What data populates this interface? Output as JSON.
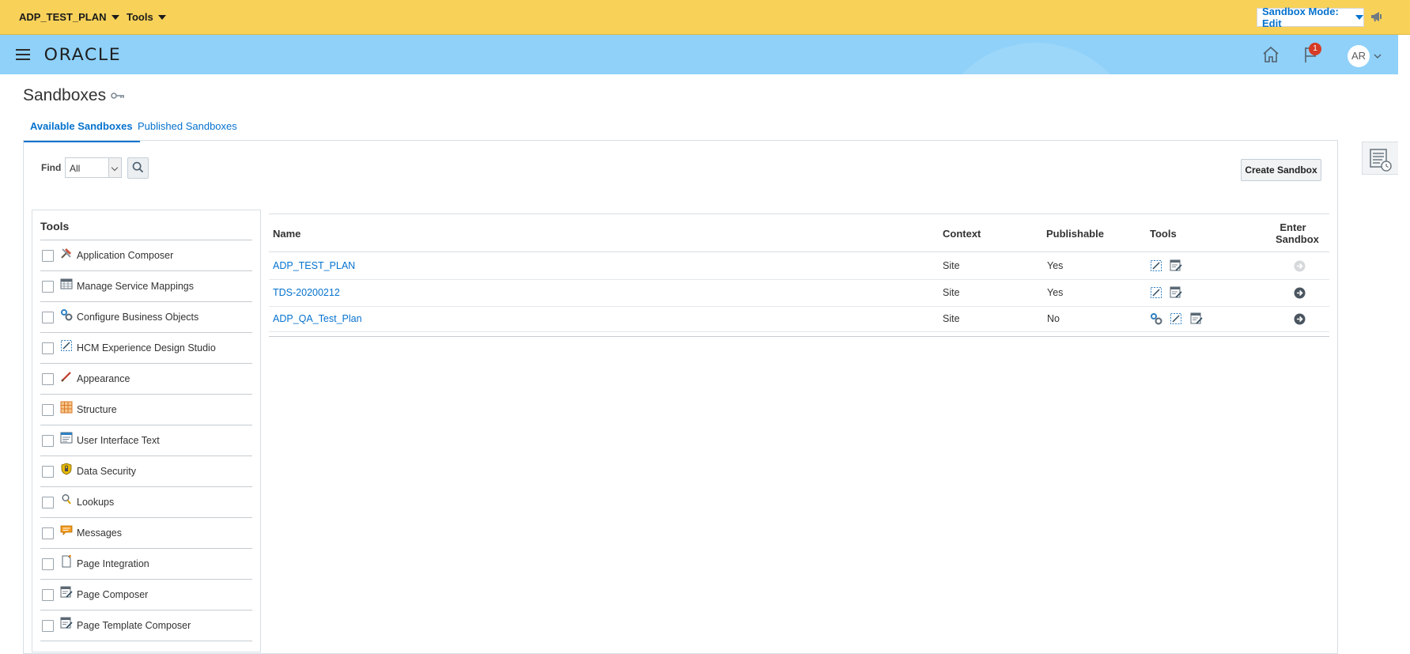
{
  "sandbox_bar": {
    "sandbox_menu": "ADP_TEST_PLAN",
    "tools_menu": "Tools",
    "mode": "Sandbox Mode: Edit"
  },
  "header": {
    "logo": "ORACLE",
    "notification_count": "1",
    "user_initials": "AR"
  },
  "page": {
    "title": "Sandboxes"
  },
  "tabs": [
    {
      "label": "Available Sandboxes",
      "active": true
    },
    {
      "label": "Published Sandboxes",
      "active": false
    }
  ],
  "find": {
    "label": "Find",
    "selected": "All"
  },
  "create_button": "Create Sandbox",
  "tools_panel": {
    "heading": "Tools",
    "items": [
      {
        "label": "Application Composer",
        "icon": "app-composer-icon"
      },
      {
        "label": "Manage Service Mappings",
        "icon": "service-mappings-icon"
      },
      {
        "label": "Configure Business Objects",
        "icon": "business-objects-icon"
      },
      {
        "label": "HCM Experience Design Studio",
        "icon": "design-studio-icon"
      },
      {
        "label": "Appearance",
        "icon": "brush-icon"
      },
      {
        "label": "Structure",
        "icon": "structure-grid-icon"
      },
      {
        "label": "User Interface Text",
        "icon": "ui-text-icon"
      },
      {
        "label": "Data Security",
        "icon": "shield-lock-icon"
      },
      {
        "label": "Lookups",
        "icon": "magnifier-icon"
      },
      {
        "label": "Messages",
        "icon": "speech-bubble-icon"
      },
      {
        "label": "Page Integration",
        "icon": "page-integration-icon"
      },
      {
        "label": "Page Composer",
        "icon": "page-composer-icon"
      },
      {
        "label": "Page Template Composer",
        "icon": "page-template-composer-icon"
      }
    ]
  },
  "table": {
    "columns": {
      "name": "Name",
      "context": "Context",
      "publishable": "Publishable",
      "tools": "Tools",
      "enter_line1": "Enter",
      "enter_line2": "Sandbox"
    },
    "rows": [
      {
        "name": "ADP_TEST_PLAN",
        "context": "Site",
        "publishable": "Yes",
        "tools": [
          "design-studio-icon",
          "page-composer-icon"
        ],
        "enter_enabled": false
      },
      {
        "name": "TDS-20200212",
        "context": "Site",
        "publishable": "Yes",
        "tools": [
          "design-studio-icon",
          "page-composer-icon"
        ],
        "enter_enabled": true
      },
      {
        "name": "ADP_QA_Test_Plan",
        "context": "Site",
        "publishable": "No",
        "tools": [
          "business-objects-icon",
          "design-studio-icon",
          "page-composer-icon"
        ],
        "enter_enabled": true
      }
    ]
  },
  "colors": {
    "sandbox_bar": "#f8d159",
    "header": "#8fd1f9",
    "link": "#0572ce"
  }
}
